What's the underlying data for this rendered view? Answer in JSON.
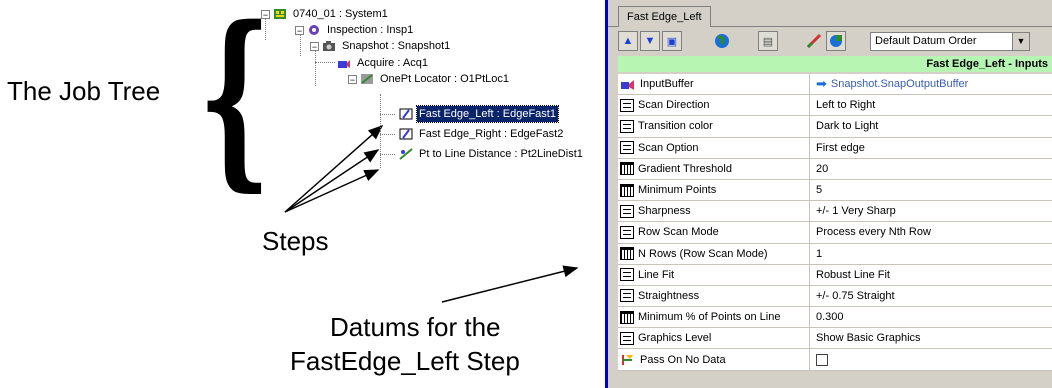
{
  "annotations": {
    "job_tree": "The Job Tree",
    "steps": "Steps",
    "datums_line1": "Datums for the",
    "datums_line2": "FastEdge_Left Step"
  },
  "tree": {
    "nodes": [
      {
        "label": "0740_01 : System1",
        "toggle": "−"
      },
      {
        "label": "Inspection : Insp1",
        "toggle": "−"
      },
      {
        "label": "Snapshot : Snapshot1",
        "toggle": "−"
      },
      {
        "label": "Acquire : Acq1",
        "toggle": ""
      },
      {
        "label": "OnePt Locator : O1PtLoc1",
        "toggle": "−"
      },
      {
        "label": "Fast Edge_Left : EdgeFast1",
        "toggle": "",
        "selected": true
      },
      {
        "label": "Fast Edge_Right : EdgeFast2",
        "toggle": ""
      },
      {
        "label": "Pt to Line Distance : Pt2LineDist1",
        "toggle": ""
      }
    ]
  },
  "panel": {
    "tab_label": "Fast Edge_Left",
    "datum_order_select": "Default Datum Order",
    "header_text": "Fast Edge_Left - Inputs",
    "header_color": "#b6f5b2",
    "rows": [
      {
        "name": "InputBuffer",
        "value": "Snapshot.SnapOutputBuffer",
        "icon": "input-buffer-icon"
      },
      {
        "name": "Scan Direction",
        "value": "Left to Right",
        "icon": "list-datum-icon"
      },
      {
        "name": "Transition color",
        "value": "Dark to Light",
        "icon": "list-datum-icon"
      },
      {
        "name": "Scan Option",
        "value": "First edge",
        "icon": "list-datum-icon"
      },
      {
        "name": "Gradient Threshold",
        "value": "20",
        "icon": "numeric-datum-icon"
      },
      {
        "name": "Minimum Points",
        "value": "5",
        "icon": "numeric-datum-icon"
      },
      {
        "name": "Sharpness",
        "value": "+/- 1 Very Sharp",
        "icon": "list-datum-icon"
      },
      {
        "name": "Row Scan Mode",
        "value": "Process every Nth Row",
        "icon": "list-datum-icon"
      },
      {
        "name": "N Rows (Row Scan Mode)",
        "value": "1",
        "icon": "numeric-datum-icon"
      },
      {
        "name": "Line Fit",
        "value": "Robust Line Fit",
        "icon": "list-datum-icon"
      },
      {
        "name": "Straightness",
        "value": "+/- 0.75 Straight",
        "icon": "list-datum-icon"
      },
      {
        "name": "Minimum % of Points on Line",
        "value": "0.300",
        "icon": "numeric-datum-icon"
      },
      {
        "name": "Graphics Level",
        "value": "Show Basic Graphics",
        "icon": "list-datum-icon"
      },
      {
        "name": "Pass On No Data",
        "value": "",
        "icon": "pass-icon",
        "checkbox": true
      }
    ]
  }
}
